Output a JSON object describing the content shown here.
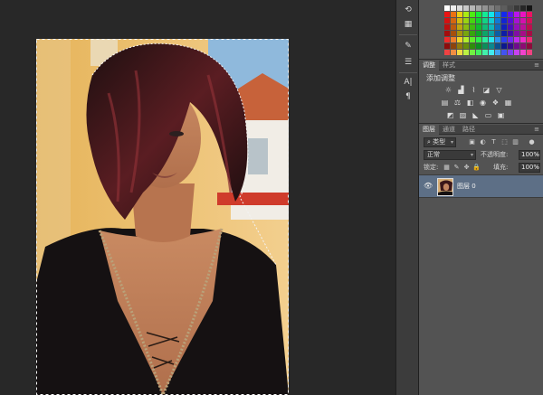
{
  "adjustments": {
    "tabs": [
      "调整",
      "样式"
    ],
    "title": "添加调整",
    "menu_icon": "panel-menu-icon"
  },
  "layers": {
    "tabs": [
      "图层",
      "通道",
      "路径"
    ],
    "filter_kind": "类型",
    "blend_mode": "正常",
    "opacity_label": "不透明度:",
    "opacity_value": "100%",
    "lock_label": "锁定:",
    "fill_label": "填充:",
    "fill_value": "100%",
    "layer_name": "图层 0"
  },
  "tool_strip": {
    "icons": [
      "history-icon",
      "swatch-icon",
      "brush-settings-icon",
      "adjust-sliders-icon",
      "character-icon",
      "paragraph-icon"
    ],
    "labels": [
      "A|",
      "¶"
    ]
  },
  "colors": {
    "panel_bg": "#535353",
    "workspace_bg": "#282828",
    "selected_layer": "#5d6f86"
  }
}
